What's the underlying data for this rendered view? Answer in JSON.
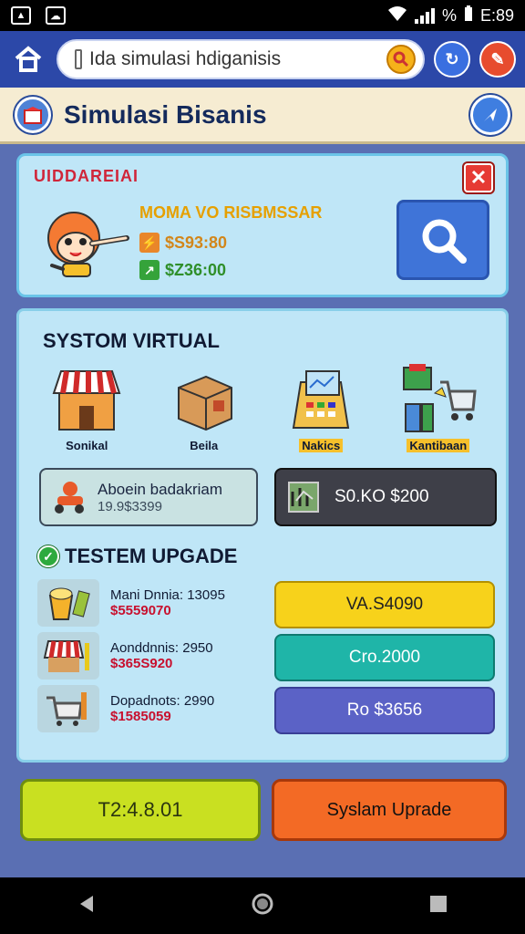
{
  "status_bar": {
    "time": "E:89",
    "battery": "%",
    "left_icons": [
      "image-icon",
      "cloud-icon"
    ]
  },
  "address_bar": {
    "url": "Ida simulasi hdiganisis"
  },
  "header": {
    "title": "Simulasi Bisanis"
  },
  "promo": {
    "tag": "UIDDAREIAI",
    "name": "MOMA VO RISBMSSAR",
    "value_1": "$S93:80",
    "value_2": "$Z36:00",
    "colors": {
      "value_1": "#d2861a",
      "value_2": "#2f8f2a"
    }
  },
  "system": {
    "title": "SYSTOM VIRTUAL",
    "categories": [
      {
        "label": "Sonikal",
        "icon": "shop-icon"
      },
      {
        "label": "Beila",
        "icon": "box-icon"
      },
      {
        "label": "Nakics",
        "icon": "register-icon"
      },
      {
        "label": "Kantibaan",
        "icon": "cart-icon"
      }
    ],
    "stat_left": {
      "line1": "Aboein badakriam",
      "line2": "19.9$3399"
    },
    "stat_right": {
      "text": "S0.KO  $200"
    }
  },
  "upgrade": {
    "title": "TESTEM UPGADE",
    "items": [
      {
        "name": "Mani Dnnia: 13095",
        "price": "$5559070",
        "icon": "bucket-icon"
      },
      {
        "name": "Aonddnnis: 2950",
        "price": "$365S920",
        "icon": "awning-icon"
      },
      {
        "name": "Dopadnots: 2990",
        "price": "$1585059",
        "icon": "trolley-icon"
      }
    ],
    "buttons": [
      {
        "label": "VA.S4090",
        "color": "#f7d21b",
        "text_color": "#222"
      },
      {
        "label": "Cro.2000",
        "color": "#1fb5a8",
        "text_color": "#fff"
      },
      {
        "label": "Ro $3656",
        "color": "#5b62c6",
        "text_color": "#fff"
      }
    ]
  },
  "bottom": {
    "left_label": "T2:4.8.01",
    "right_label": "Syslam Uprade"
  }
}
